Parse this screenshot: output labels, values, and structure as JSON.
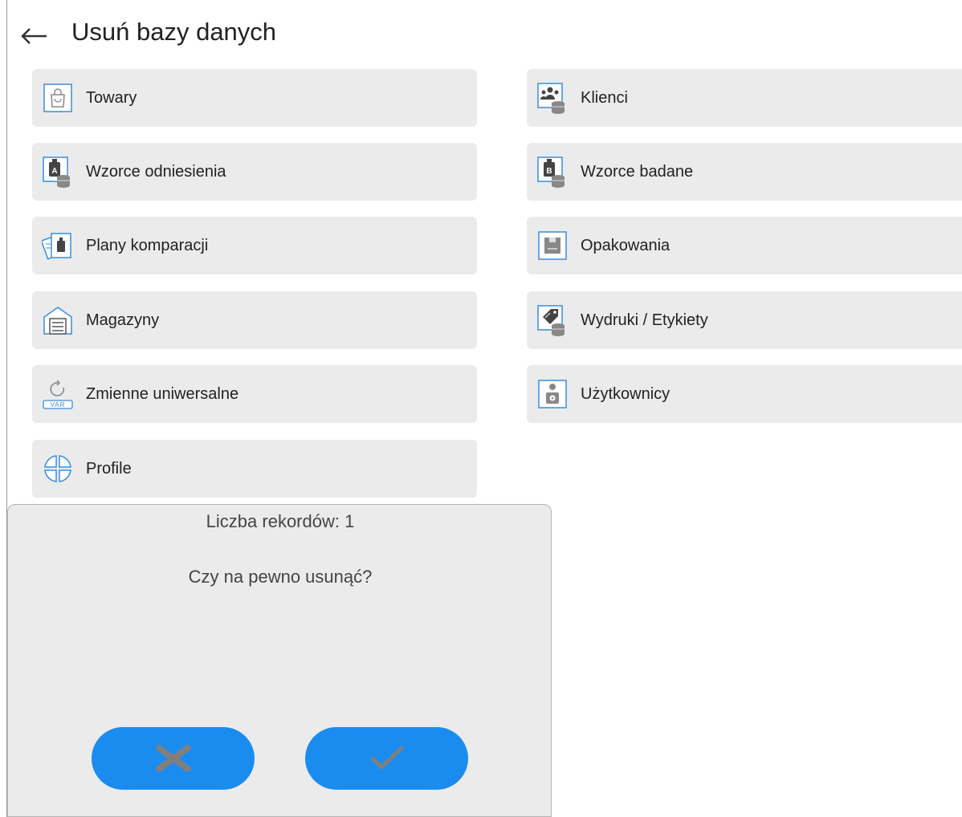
{
  "header": {
    "title": "Usuń bazy danych",
    "back_icon": "arrow-left-icon"
  },
  "tiles_left": [
    {
      "label": "Towary",
      "icon": "shopping-bag-icon"
    },
    {
      "label": "Wzorce odniesienia",
      "icon": "reference-weight-database-icon"
    },
    {
      "label": "Plany komparacji",
      "icon": "comparison-plan-icon"
    },
    {
      "label": "Magazyny",
      "icon": "warehouse-icon"
    },
    {
      "label": "Zmienne uniwersalne",
      "icon": "universal-variable-icon"
    },
    {
      "label": "Profile",
      "icon": "profile-icon"
    }
  ],
  "tiles_right": [
    {
      "label": "Klienci",
      "icon": "customers-database-icon"
    },
    {
      "label": "Wzorce badane",
      "icon": "tested-weight-database-icon"
    },
    {
      "label": "Opakowania",
      "icon": "packaging-icon"
    },
    {
      "label": "Wydruki / Etykiety",
      "icon": "printout-label-database-icon"
    },
    {
      "label": "Użytkownicy",
      "icon": "users-icon"
    }
  ],
  "dialog": {
    "record_count": "Liczba rekordów: 1",
    "question": "Czy na pewno usunąć?",
    "cancel_icon": "close-icon",
    "confirm_icon": "check-icon"
  },
  "colors": {
    "accent": "#1a8cf0",
    "icon_blue": "#3a8de0",
    "tile_bg": "#ebebeb",
    "button_glyph": "#7f7f7f"
  }
}
